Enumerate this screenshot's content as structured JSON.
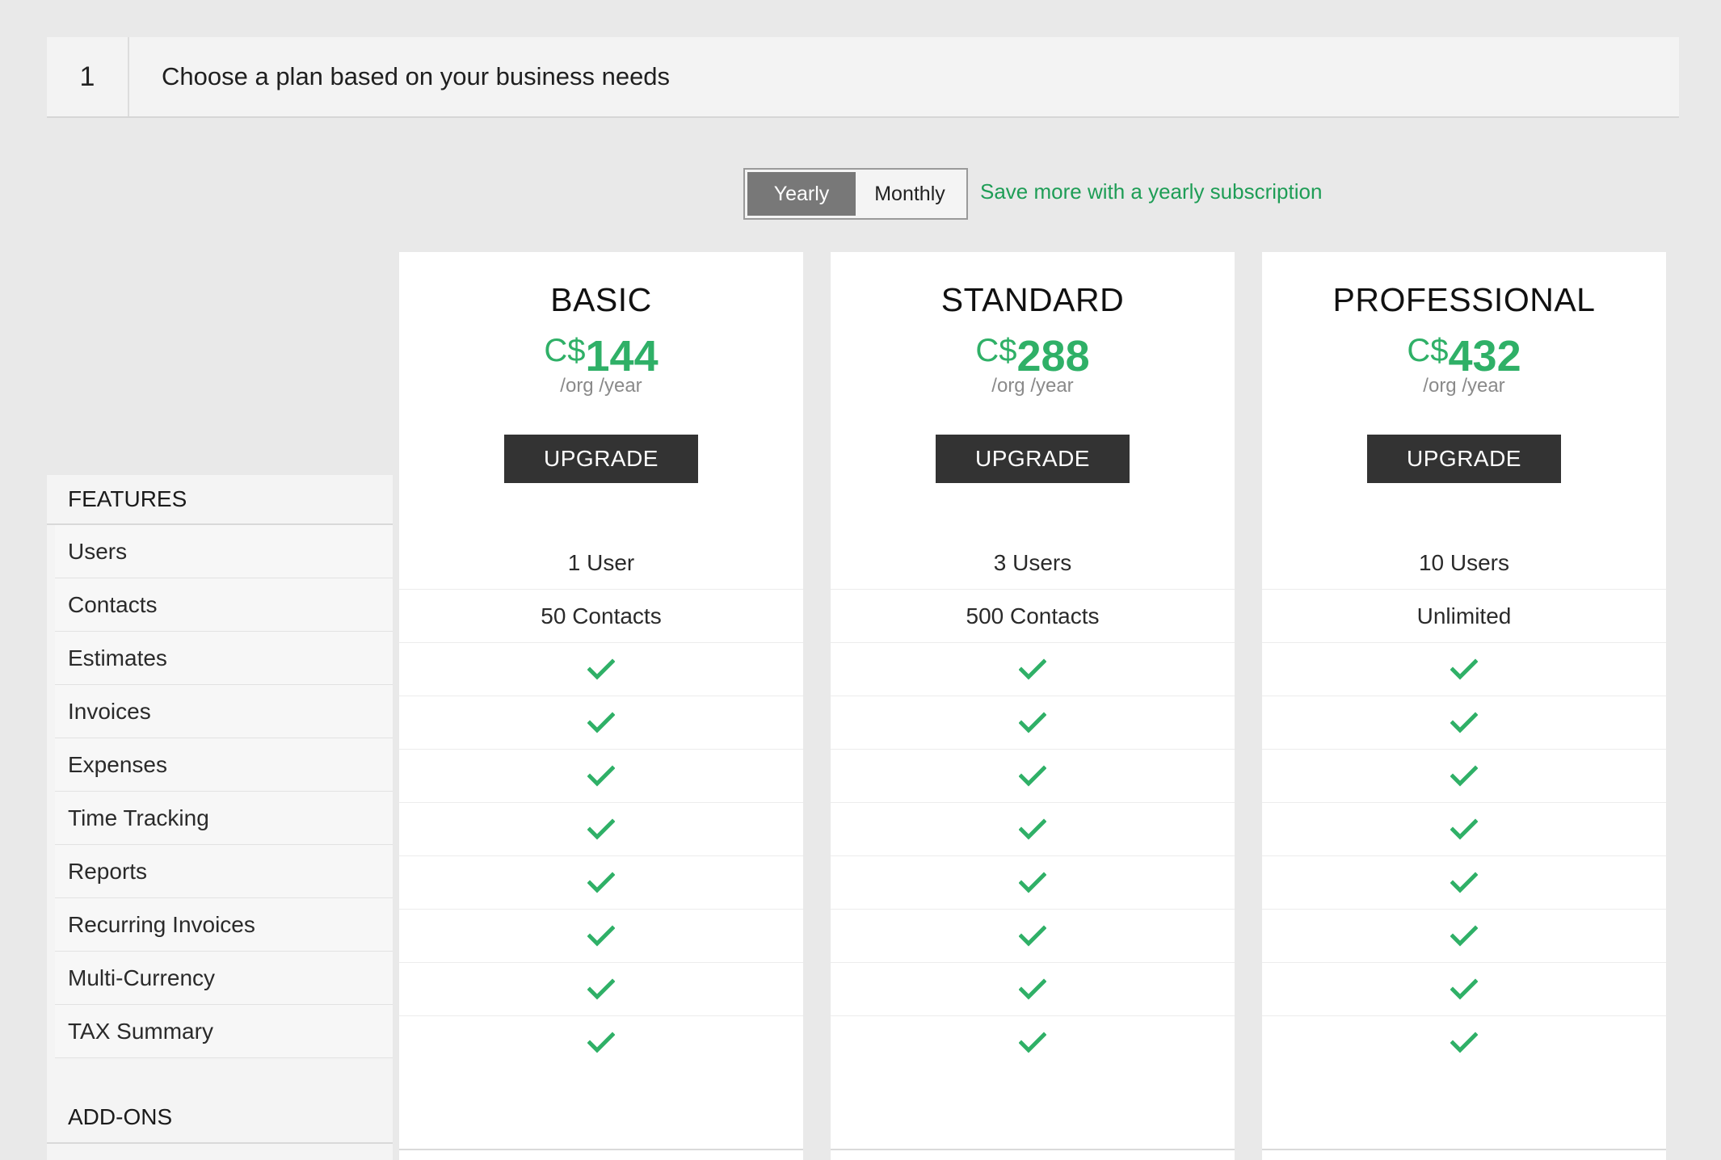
{
  "step": {
    "number": "1",
    "title": "Choose a plan based on your business needs"
  },
  "billing": {
    "options": [
      "Yearly",
      "Monthly"
    ],
    "selected": "Yearly",
    "note": "Save more with a yearly subscription"
  },
  "features": {
    "heading": "FEATURES",
    "items": [
      "Users",
      "Contacts",
      "Estimates",
      "Invoices",
      "Expenses",
      "Time Tracking",
      "Reports",
      "Recurring Invoices",
      "Multi-Currency",
      "TAX Summary"
    ],
    "addons_heading": "ADD-ONS"
  },
  "plans": [
    {
      "name": "BASIC",
      "currency": "C$",
      "amount": "144",
      "period": "/org /year",
      "cta": "UPGRADE",
      "users": "1 User",
      "contacts": "50 Contacts"
    },
    {
      "name": "STANDARD",
      "currency": "C$",
      "amount": "288",
      "period": "/org /year",
      "cta": "UPGRADE",
      "users": "3 Users",
      "contacts": "500 Contacts"
    },
    {
      "name": "PROFESSIONAL",
      "currency": "C$",
      "amount": "432",
      "period": "/org /year",
      "cta": "UPGRADE",
      "users": "10 Users",
      "contacts": "Unlimited"
    }
  ],
  "icons": {
    "included": "check-icon"
  },
  "colors": {
    "accent_green": "#2fb067",
    "button_dark": "#333333",
    "toggle_active": "#787878"
  }
}
